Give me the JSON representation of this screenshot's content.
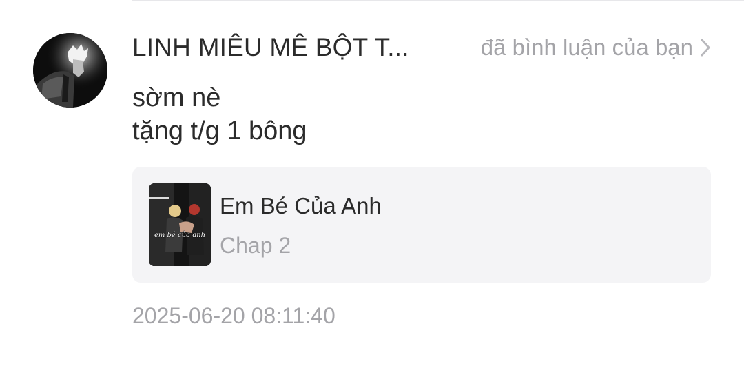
{
  "notification": {
    "username": "LINH MIÊU MÊ BỘT T...",
    "action": "đã bình luận của bạn",
    "comment_lines": [
      "sờm nè",
      "tặng t/g 1 bông"
    ],
    "story": {
      "title": "Em Bé Của Anh",
      "chapter": "Chap 2",
      "cover_text": "em bé của anh"
    },
    "timestamp": "2025-06-20 08:11:40"
  },
  "icons": {
    "avatar": "user-avatar",
    "chevron": "chevron-right-icon"
  },
  "colors": {
    "primary_text": "#2b2b2b",
    "secondary_text": "#a4a4a8",
    "card_background": "#f4f4f6",
    "divider": "#e7e7ea"
  }
}
